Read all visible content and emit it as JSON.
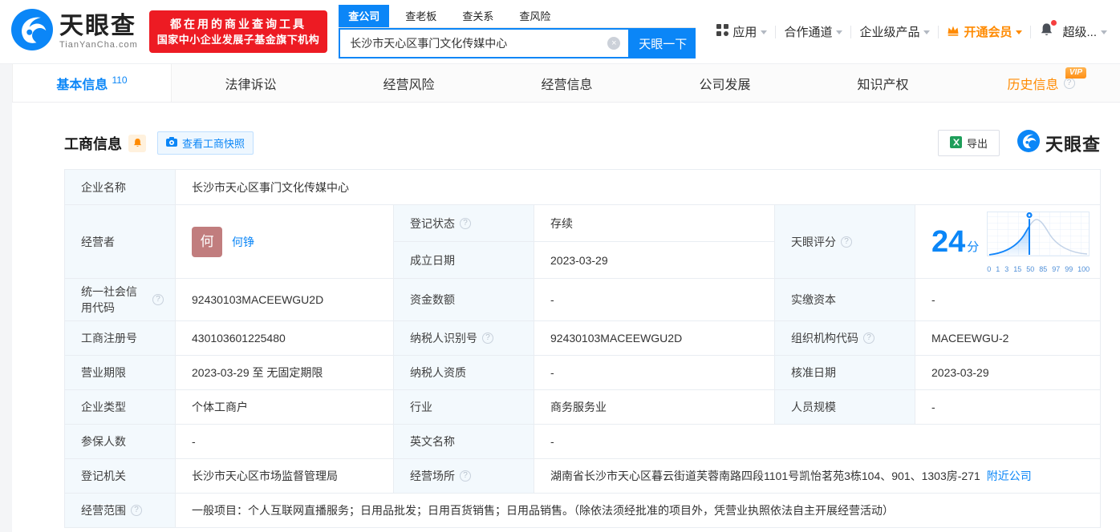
{
  "header": {
    "logo": {
      "title": "天眼查",
      "subtitle": "TianYanCha.com"
    },
    "promo": {
      "line1": "都在用的商业查询工具",
      "line2": "国家中小企业发展子基金旗下机构"
    },
    "search": {
      "tabs": [
        {
          "label": "查公司",
          "active": true
        },
        {
          "label": "查老板",
          "active": false
        },
        {
          "label": "查关系",
          "active": false
        },
        {
          "label": "查风险",
          "active": false
        }
      ],
      "value": "长沙市天心区事门文化传媒中心",
      "button_label": "天眼一下"
    },
    "nav": [
      {
        "label": "应用"
      },
      {
        "label": "合作通道"
      },
      {
        "label": "企业级产品"
      },
      {
        "label": "开通会员"
      },
      {
        "label": "超级..."
      }
    ]
  },
  "tabs": [
    {
      "label": "基本信息",
      "count": "110"
    },
    {
      "label": "法律诉讼"
    },
    {
      "label": "经营风险"
    },
    {
      "label": "经营信息"
    },
    {
      "label": "公司发展"
    },
    {
      "label": "知识产权"
    },
    {
      "label": "历史信息",
      "vip": "VIP"
    }
  ],
  "section": {
    "title": "工商信息",
    "snapshot_button": "查看工商快照",
    "export_button": "导出",
    "brand": "天眼查"
  },
  "info": {
    "company_name": {
      "label": "企业名称",
      "value": "长沙市天心区事门文化传媒中心"
    },
    "operator": {
      "label": "经营者",
      "avatar_text": "何",
      "name": "何铮"
    },
    "reg_status": {
      "label": "登记状态",
      "value": "存续"
    },
    "establish_date": {
      "label": "成立日期",
      "value": "2023-03-29"
    },
    "score": {
      "label": "天眼评分",
      "value": "24",
      "unit": "分"
    },
    "credit_code": {
      "label": "统一社会信用代码",
      "value": "92430103MACEEWGU2D"
    },
    "capital_amount": {
      "label": "资金数额",
      "value": "-"
    },
    "paid_capital": {
      "label": "实缴资本",
      "value": "-"
    },
    "reg_number": {
      "label": "工商注册号",
      "value": "430103601225480"
    },
    "taxpayer_id": {
      "label": "纳税人识别号",
      "value": "92430103MACEEWGU2D"
    },
    "org_code": {
      "label": "组织机构代码",
      "value": "MACEEWGU-2"
    },
    "business_term": {
      "label": "营业期限",
      "value": "2023-03-29 至 无固定期限"
    },
    "taxpayer_quality": {
      "label": "纳税人资质",
      "value": "-"
    },
    "approval_date": {
      "label": "核准日期",
      "value": "2023-03-29"
    },
    "company_type": {
      "label": "企业类型",
      "value": "个体工商户"
    },
    "industry": {
      "label": "行业",
      "value": "商务服务业"
    },
    "staff_size": {
      "label": "人员规模",
      "value": "-"
    },
    "insured_count": {
      "label": "参保人数",
      "value": "-"
    },
    "english_name": {
      "label": "英文名称",
      "value": "-"
    },
    "reg_authority": {
      "label": "登记机关",
      "value": "长沙市天心区市场监督管理局"
    },
    "business_site": {
      "label": "经营场所",
      "value": "湖南省长沙市天心区暮云街道芙蓉南路四段1101号凯怡茗苑3栋104、901、1303房-271",
      "nearby_link": "附近公司"
    },
    "business_scope": {
      "label": "经营范围",
      "value": "一般项目：个人互联网直播服务；日用品批发；日用百货销售；日用品销售。（除依法须经批准的项目外，凭营业执照依法自主开展经营活动）"
    }
  },
  "chart_data": {
    "type": "area",
    "title": "天眼评分分布曲线",
    "score": 24,
    "marker_value": 24,
    "x_ticks": [
      "0",
      "1",
      "3",
      "15",
      "50",
      "85",
      "97",
      "99",
      "100"
    ],
    "xlabel": "",
    "ylabel": "",
    "grid": true,
    "note": "正态分布形曲线，峰值位于50附近，24分标记线位于峰值左侧，标记线左侧区域填充蓝色"
  }
}
